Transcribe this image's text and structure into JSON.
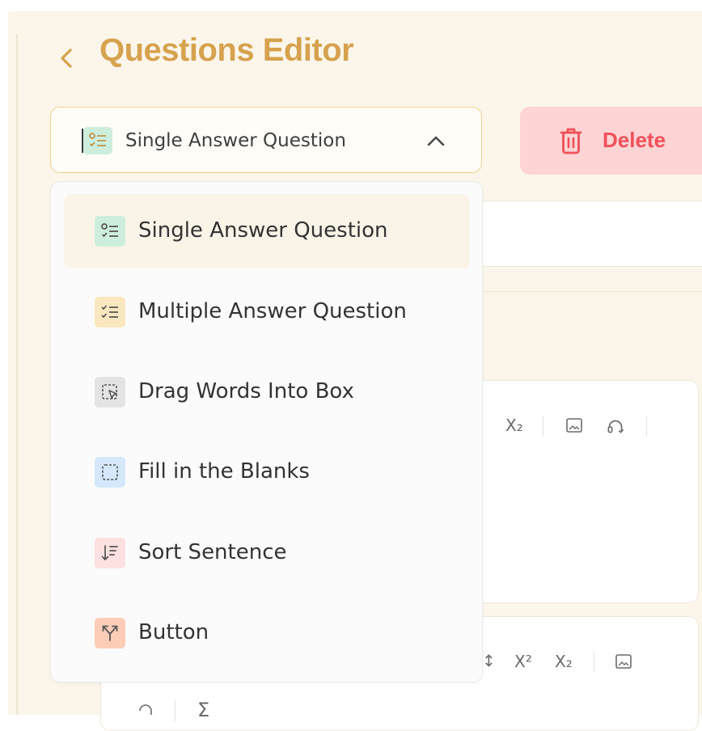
{
  "header": {
    "title": "Questions Editor"
  },
  "select": {
    "value": "Single Answer Question"
  },
  "delete": {
    "label": "Delete"
  },
  "menu": {
    "items": [
      {
        "label": "Single Answer Question",
        "icon": "single-answer-icon",
        "bg": "#cdeedd"
      },
      {
        "label": "Multiple Answer Question",
        "icon": "multiple-answer-icon",
        "bg": "#fbe7bf"
      },
      {
        "label": "Drag Words Into Box",
        "icon": "drag-words-icon",
        "bg": "#e4e4e4"
      },
      {
        "label": "Fill in the Blanks",
        "icon": "fill-blanks-icon",
        "bg": "#d5e8fb"
      },
      {
        "label": "Sort Sentence",
        "icon": "sort-sentence-icon",
        "bg": "#fde0e0"
      },
      {
        "label": "Button",
        "icon": "button-branch-icon",
        "bg": "#fdcdb8"
      }
    ]
  },
  "toolbar": {
    "subscript_label": "X₂",
    "superscript_label": "X²",
    "sigma": "Σ"
  },
  "colors": {
    "accent": "#d6a24f",
    "danger": "#f0505a",
    "danger_bg": "#ffd4d4",
    "page_bg": "#fcf6ea"
  }
}
